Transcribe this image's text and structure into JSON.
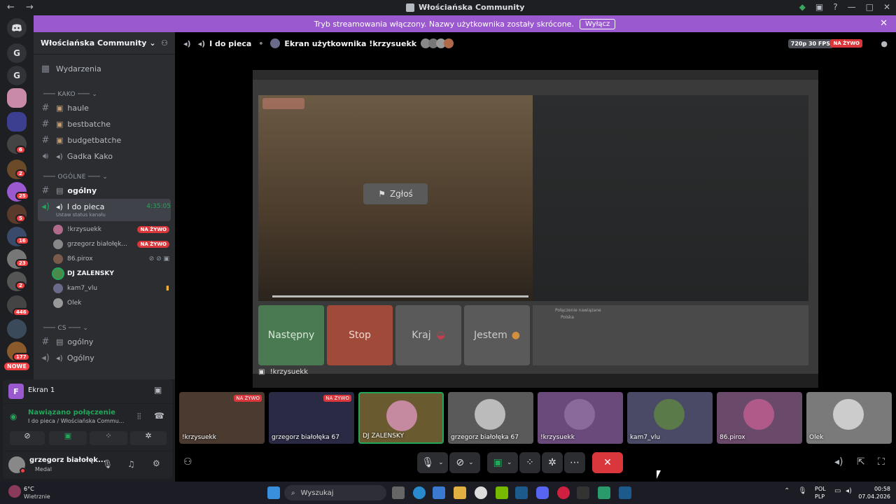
{
  "titlebar": {
    "title": "Włościańska Community",
    "nav": "← →"
  },
  "banner": {
    "text": "Tryb streamowania włączony. Nazwy użytkownika zostały skrócone.",
    "button": "Wyłącz"
  },
  "guilds": {
    "letter_g1": "G",
    "letter_g2": "G",
    "badges": [
      "6",
      "2",
      "25",
      "5",
      "16",
      "23",
      "2",
      "446",
      "177"
    ],
    "new_label": "NOWE"
  },
  "sidebar": {
    "server_name": "Włościańska Community",
    "events": "Wydarzenia",
    "categories": {
      "kako": "KAKO",
      "ogolne": "OGÓLNE",
      "cs": "CS"
    },
    "channels": {
      "haule": "haule",
      "bestbatche": "bestbatche",
      "budgetbatche": "budgetbatche",
      "gadka_kako": "Gadka Kako",
      "ogolny": "ogólny",
      "i_do_pieca": "I do pieca",
      "i_do_pieca_time": "4:35:05",
      "i_do_pieca_status": "Ustaw status kanału",
      "cs_ogolny": "ogólny",
      "cs_Ogolny": "Ogólny"
    },
    "members": [
      {
        "name": "!krzysuekk",
        "live": "NA ŻYWO"
      },
      {
        "name": "grzegorz białołęk...",
        "live": "NA ŻYWO"
      },
      {
        "name": "86.pirox",
        "live": ""
      },
      {
        "name": "DJ ZALENSKY",
        "live": ""
      },
      {
        "name": "kam7_vlu",
        "live": ""
      },
      {
        "name": "Olek",
        "live": ""
      }
    ]
  },
  "voicepanel": {
    "ekran": "Ekran 1",
    "connected": "Nawiązano połączenie",
    "connected_sub": "I do pieca / Włościańska Commu...",
    "user": "grzegorz białołęk...",
    "user_status": "Medal"
  },
  "stage": {
    "channel": "I do pieca",
    "screen_label": "Ekran użytkownika !krzysuekk",
    "quality": "720p 30 FPS",
    "live": "NA ŻYWO",
    "report": "Zgłoś",
    "streamer_label": "!krzysuekk",
    "ometv_buttons": {
      "next": "Następny",
      "stop": "Stop",
      "country": "Kraj",
      "iam": "Jestem"
    },
    "ometv_chat_title": "Połączenie nawiązane",
    "ometv_chat_sub": "Polska"
  },
  "tiles": [
    {
      "name": "!krzysuekk",
      "live": "NA ŻYWO"
    },
    {
      "name": "grzegorz białołęka 67",
      "live": "NA ŻYWO"
    },
    {
      "name": "DJ ZALENSKY",
      "live": ""
    },
    {
      "name": "grzegorz białołęka 67",
      "live": ""
    },
    {
      "name": "!krzysuekk",
      "live": ""
    },
    {
      "name": "kam7_vlu",
      "live": ""
    },
    {
      "name": "86.pirox",
      "live": ""
    },
    {
      "name": "Olek",
      "live": ""
    }
  ],
  "taskbar": {
    "weather_temp": "6°C",
    "weather_desc": "Wietrznie",
    "search": "Wyszukaj",
    "lang1": "POL",
    "lang2": "PLP",
    "time": "00:58",
    "date": "07.04.2026"
  }
}
